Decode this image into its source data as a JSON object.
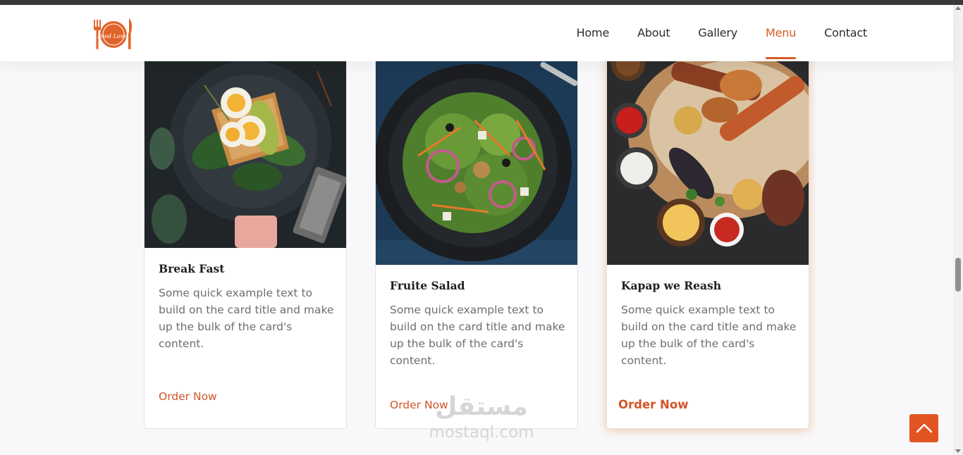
{
  "brand": {
    "logo_text": "Food Lover",
    "accent_color": "#d95a28"
  },
  "nav": {
    "items": [
      {
        "label": "Home",
        "active": false
      },
      {
        "label": "About",
        "active": false
      },
      {
        "label": "Gallery",
        "active": false
      },
      {
        "label": "Menu",
        "active": true
      },
      {
        "label": "Contact",
        "active": false
      }
    ]
  },
  "cards": [
    {
      "title": "Break Fast",
      "text": "Some quick example text to build on the card title and make up the bulk of the card's content.",
      "link": "Order Now",
      "image": "breakfast-eggs-avocado-photo"
    },
    {
      "title": "Fruite Salad",
      "text": "Some quick example text to build on the card title and make up the bulk of the card's content.",
      "link": "Order Now",
      "image": "salad-bowl-photo"
    },
    {
      "title": "Kapap we Reash",
      "text": "Some quick example text to build on the card title and make up the bulk of the card's content.",
      "link": "Order Now",
      "image": "grilled-kebab-platter-photo"
    }
  ],
  "watermark": {
    "arabic": "مستقل",
    "latin": "mostaql.com"
  },
  "back_to_top": {
    "icon": "chevron-up-icon"
  }
}
